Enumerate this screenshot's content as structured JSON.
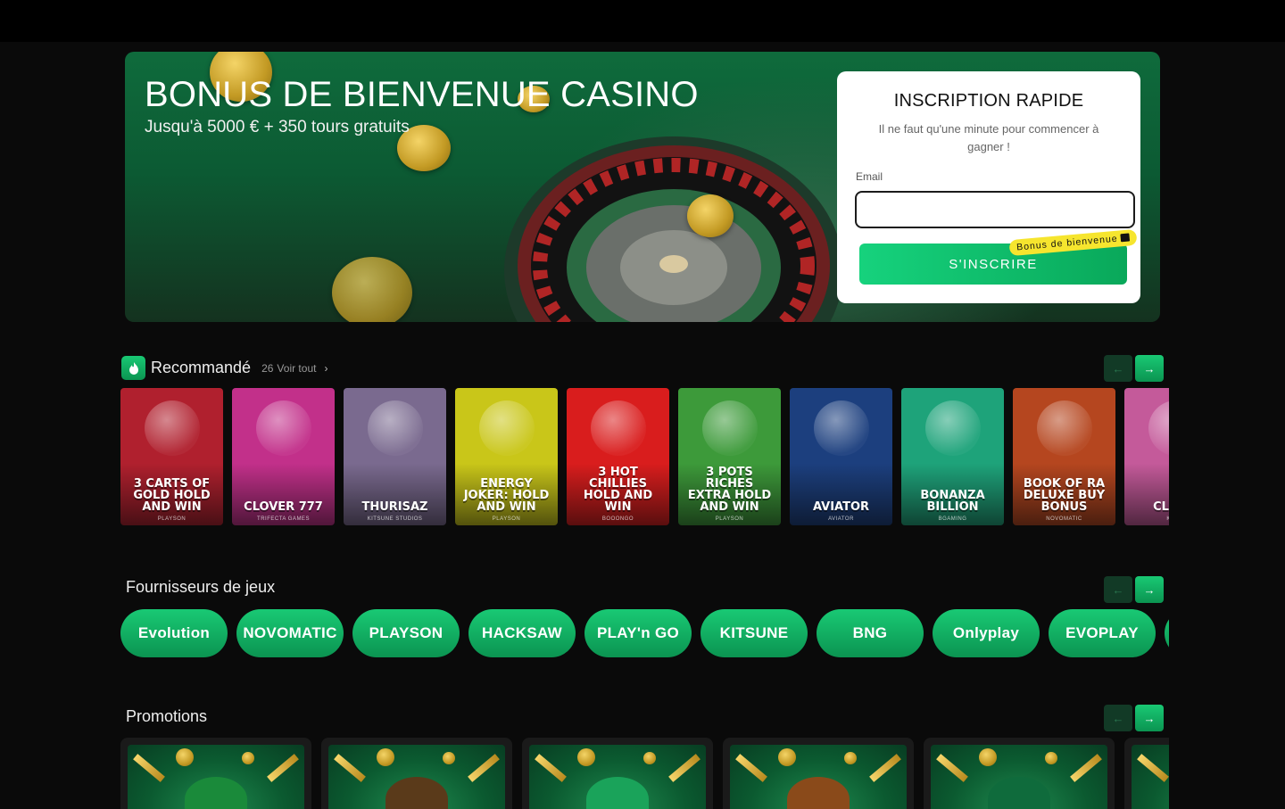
{
  "hero": {
    "title": "BONUS DE BIENVENUE CASINO",
    "subtitle": "Jusqu'à 5000 € + 350 tours gratuits"
  },
  "signup": {
    "title": "INSCRIPTION RAPIDE",
    "note": "Il ne faut qu'une minute pour commencer à gagner !",
    "email_label": "Email",
    "email_value": "",
    "button": "S'INSCRIRE",
    "badge": "Bonus de bienvenue",
    "badge_icon": "gift-icon"
  },
  "recommended": {
    "title": "Recommandé",
    "count": "26",
    "see_all": "Voir tout",
    "games": [
      {
        "title": "3 Carts of Gold Hold and Win",
        "provider": "PLAYSON",
        "bg": "#b0202e"
      },
      {
        "title": "Clover 777",
        "provider": "TRIFECTA GAMES",
        "bg": "#c2308a"
      },
      {
        "title": "Thurisaz",
        "provider": "KITSUNE STUDIOS",
        "bg": "#7a6a8f"
      },
      {
        "title": "Energy Joker: Hold and Win",
        "provider": "PLAYSON",
        "bg": "#c9c619"
      },
      {
        "title": "3 Hot Chillies Hold and Win",
        "provider": "BOOONGO",
        "bg": "#d91d1d"
      },
      {
        "title": "3 Pots Riches Extra Hold and Win",
        "provider": "PLAYSON",
        "bg": "#3d9a3a"
      },
      {
        "title": "Aviator",
        "provider": "AVIATOR",
        "bg": "#1c3f7e"
      },
      {
        "title": "Bonanza Billion",
        "provider": "BGAMING",
        "bg": "#1ea37a"
      },
      {
        "title": "Book of Ra Deluxe Buy Bonus",
        "provider": "NOVOMATIC",
        "bg": "#b5461f"
      },
      {
        "title": "Cl Cae",
        "provider": "KITSU",
        "bg": "#c45a9a"
      }
    ]
  },
  "providers": {
    "title": "Fournisseurs de jeux",
    "items": [
      "Evolution",
      "NOVOMATIC",
      "PLAYSON",
      "HACKSAW",
      "PLAY'n GO",
      "KITSUNE",
      "BNG",
      "Onlyplay",
      "EVOPLAY",
      ""
    ]
  },
  "promotions": {
    "title": "Promotions",
    "items": [
      {
        "obj": "#1a8a3a"
      },
      {
        "obj": "#5a3a1a"
      },
      {
        "obj": "#1aa35a"
      },
      {
        "obj": "#8a4a1a"
      },
      {
        "obj": "#0f6b3c"
      },
      {
        "obj": "#0f6b3c"
      }
    ]
  },
  "nav": {
    "prev_icon": "arrow-left-icon",
    "next_icon": "arrow-right-icon"
  }
}
